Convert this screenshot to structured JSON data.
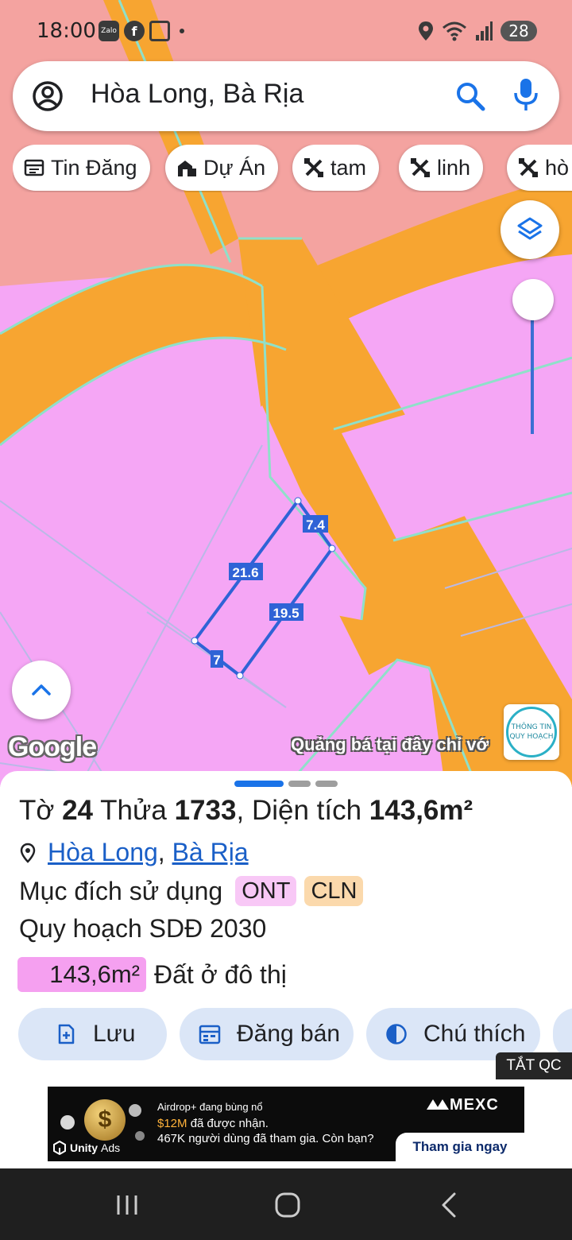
{
  "status_bar": {
    "time": "18:00",
    "zalo_label": "Zalo",
    "battery": "28"
  },
  "search": {
    "query": "Hòa Long, Bà Rịa"
  },
  "chips": [
    {
      "label": "Tin Đăng",
      "icon": "listing-icon"
    },
    {
      "label": "Dự Án",
      "icon": "project-icon"
    },
    {
      "label": "tam",
      "icon": "tools-icon"
    },
    {
      "label": "linh",
      "icon": "tools-icon"
    },
    {
      "label": "hò",
      "icon": "tools-icon"
    }
  ],
  "map": {
    "dimensions": {
      "top": "7.4",
      "left": "21.6",
      "right": "19.5",
      "bottom": "7"
    },
    "google_logo": "Google",
    "ad_hint": "Quảng bá tại đây chỉ vớ",
    "badge_line1": "THÔNG TIN",
    "badge_line2": "QUY HOẠCH",
    "colors": {
      "residential": "#f5a6f5",
      "road": "#f7a531",
      "boundary": "#2f63d6"
    }
  },
  "parcel": {
    "sheet_label": "Tờ",
    "sheet_number": "24",
    "plot_label": "Thửa",
    "plot_number": "1733",
    "area_label": "Diện tích",
    "area_value": "143,6m²",
    "location_ward": "Hòa Long",
    "location_separator": ",",
    "location_city": "Bà Rịa",
    "purpose_label": "Mục đích sử dụng",
    "purpose_tags": [
      "ONT",
      "CLN"
    ],
    "plan_title": "Quy hoạch SDĐ 2030",
    "plan_area": "143,6m²",
    "plan_area_type": "Đất ở đô thị"
  },
  "actions": [
    {
      "label": "Lưu",
      "icon": "bookmark-add-icon"
    },
    {
      "label": "Đăng bán",
      "icon": "calendar-icon"
    },
    {
      "label": "Chú thích",
      "icon": "contrast-icon"
    }
  ],
  "ad": {
    "close_label": "TẮT QC",
    "coin_symbol": "$",
    "line1": "Airdrop+ đang bùng nổ",
    "line2_highlight": "$12M",
    "line2_rest": " đã được nhận.",
    "line3": "467K người dùng đã tham gia. Còn bạn?",
    "brand": "MEXC",
    "cta": "Tham gia ngay",
    "network": "Unity",
    "network_suffix": "Ads"
  }
}
